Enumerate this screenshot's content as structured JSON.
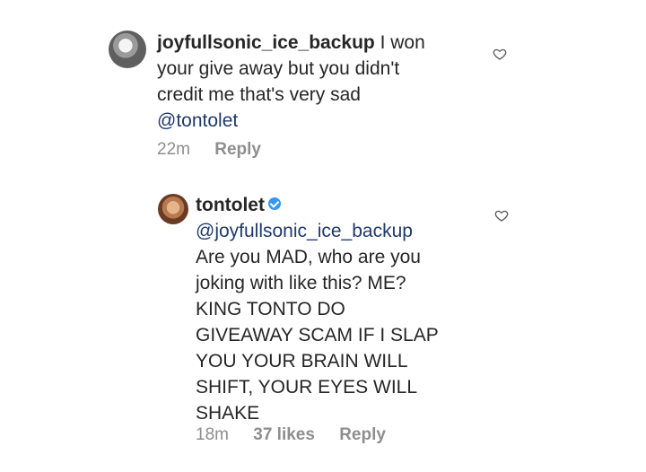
{
  "comments": [
    {
      "username": "joyfullsonic_ice_backup",
      "text_after_username": " I won\nyour give away but you didn't\ncredit me that's very sad\n",
      "mention": "@tontolet",
      "time": "22m",
      "reply_label": "Reply"
    },
    {
      "username": "tontolet",
      "verified": true,
      "mention": "@joyfullsonic_ice_backup",
      "text": "Are you MAD, who are you\njoking with like this? ME?\nKING TONTO DO\nGIVEAWAY SCAM IF I SLAP\nYOU YOUR BRAIN WILL\nSHIFT, YOUR EYES WILL\nSHAKE",
      "time": "18m",
      "likes": "37 likes",
      "reply_label": "Reply"
    }
  ],
  "icons": {
    "like": "heart-icon",
    "verified": "verified-icon"
  },
  "colors": {
    "text": "#262626",
    "meta": "#8e8e8e",
    "mention": "#1f3a6b",
    "verified": "#3897f0"
  }
}
